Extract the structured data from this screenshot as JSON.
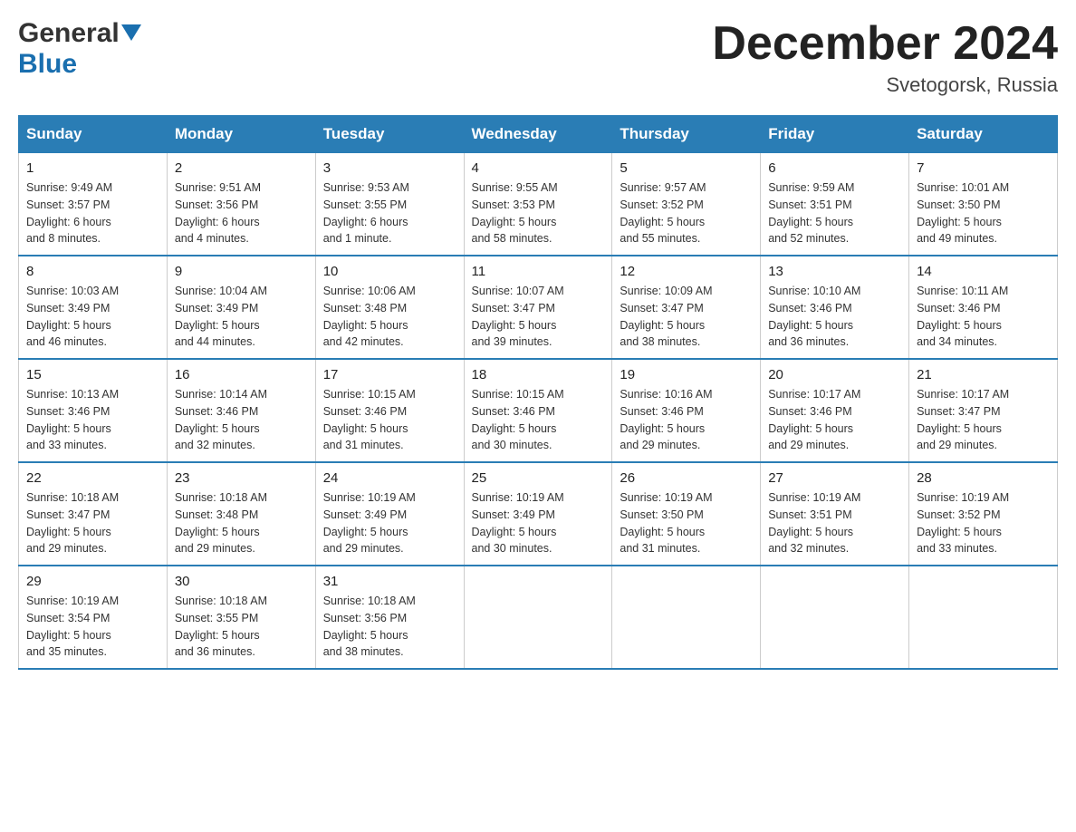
{
  "header": {
    "title": "December 2024",
    "location": "Svetogorsk, Russia",
    "logo_general": "General",
    "logo_blue": "Blue"
  },
  "days_of_week": [
    "Sunday",
    "Monday",
    "Tuesday",
    "Wednesday",
    "Thursday",
    "Friday",
    "Saturday"
  ],
  "weeks": [
    [
      {
        "day": "1",
        "sunrise": "Sunrise: 9:49 AM",
        "sunset": "Sunset: 3:57 PM",
        "daylight": "Daylight: 6 hours",
        "daylight2": "and 8 minutes."
      },
      {
        "day": "2",
        "sunrise": "Sunrise: 9:51 AM",
        "sunset": "Sunset: 3:56 PM",
        "daylight": "Daylight: 6 hours",
        "daylight2": "and 4 minutes."
      },
      {
        "day": "3",
        "sunrise": "Sunrise: 9:53 AM",
        "sunset": "Sunset: 3:55 PM",
        "daylight": "Daylight: 6 hours",
        "daylight2": "and 1 minute."
      },
      {
        "day": "4",
        "sunrise": "Sunrise: 9:55 AM",
        "sunset": "Sunset: 3:53 PM",
        "daylight": "Daylight: 5 hours",
        "daylight2": "and 58 minutes."
      },
      {
        "day": "5",
        "sunrise": "Sunrise: 9:57 AM",
        "sunset": "Sunset: 3:52 PM",
        "daylight": "Daylight: 5 hours",
        "daylight2": "and 55 minutes."
      },
      {
        "day": "6",
        "sunrise": "Sunrise: 9:59 AM",
        "sunset": "Sunset: 3:51 PM",
        "daylight": "Daylight: 5 hours",
        "daylight2": "and 52 minutes."
      },
      {
        "day": "7",
        "sunrise": "Sunrise: 10:01 AM",
        "sunset": "Sunset: 3:50 PM",
        "daylight": "Daylight: 5 hours",
        "daylight2": "and 49 minutes."
      }
    ],
    [
      {
        "day": "8",
        "sunrise": "Sunrise: 10:03 AM",
        "sunset": "Sunset: 3:49 PM",
        "daylight": "Daylight: 5 hours",
        "daylight2": "and 46 minutes."
      },
      {
        "day": "9",
        "sunrise": "Sunrise: 10:04 AM",
        "sunset": "Sunset: 3:49 PM",
        "daylight": "Daylight: 5 hours",
        "daylight2": "and 44 minutes."
      },
      {
        "day": "10",
        "sunrise": "Sunrise: 10:06 AM",
        "sunset": "Sunset: 3:48 PM",
        "daylight": "Daylight: 5 hours",
        "daylight2": "and 42 minutes."
      },
      {
        "day": "11",
        "sunrise": "Sunrise: 10:07 AM",
        "sunset": "Sunset: 3:47 PM",
        "daylight": "Daylight: 5 hours",
        "daylight2": "and 39 minutes."
      },
      {
        "day": "12",
        "sunrise": "Sunrise: 10:09 AM",
        "sunset": "Sunset: 3:47 PM",
        "daylight": "Daylight: 5 hours",
        "daylight2": "and 38 minutes."
      },
      {
        "day": "13",
        "sunrise": "Sunrise: 10:10 AM",
        "sunset": "Sunset: 3:46 PM",
        "daylight": "Daylight: 5 hours",
        "daylight2": "and 36 minutes."
      },
      {
        "day": "14",
        "sunrise": "Sunrise: 10:11 AM",
        "sunset": "Sunset: 3:46 PM",
        "daylight": "Daylight: 5 hours",
        "daylight2": "and 34 minutes."
      }
    ],
    [
      {
        "day": "15",
        "sunrise": "Sunrise: 10:13 AM",
        "sunset": "Sunset: 3:46 PM",
        "daylight": "Daylight: 5 hours",
        "daylight2": "and 33 minutes."
      },
      {
        "day": "16",
        "sunrise": "Sunrise: 10:14 AM",
        "sunset": "Sunset: 3:46 PM",
        "daylight": "Daylight: 5 hours",
        "daylight2": "and 32 minutes."
      },
      {
        "day": "17",
        "sunrise": "Sunrise: 10:15 AM",
        "sunset": "Sunset: 3:46 PM",
        "daylight": "Daylight: 5 hours",
        "daylight2": "and 31 minutes."
      },
      {
        "day": "18",
        "sunrise": "Sunrise: 10:15 AM",
        "sunset": "Sunset: 3:46 PM",
        "daylight": "Daylight: 5 hours",
        "daylight2": "and 30 minutes."
      },
      {
        "day": "19",
        "sunrise": "Sunrise: 10:16 AM",
        "sunset": "Sunset: 3:46 PM",
        "daylight": "Daylight: 5 hours",
        "daylight2": "and 29 minutes."
      },
      {
        "day": "20",
        "sunrise": "Sunrise: 10:17 AM",
        "sunset": "Sunset: 3:46 PM",
        "daylight": "Daylight: 5 hours",
        "daylight2": "and 29 minutes."
      },
      {
        "day": "21",
        "sunrise": "Sunrise: 10:17 AM",
        "sunset": "Sunset: 3:47 PM",
        "daylight": "Daylight: 5 hours",
        "daylight2": "and 29 minutes."
      }
    ],
    [
      {
        "day": "22",
        "sunrise": "Sunrise: 10:18 AM",
        "sunset": "Sunset: 3:47 PM",
        "daylight": "Daylight: 5 hours",
        "daylight2": "and 29 minutes."
      },
      {
        "day": "23",
        "sunrise": "Sunrise: 10:18 AM",
        "sunset": "Sunset: 3:48 PM",
        "daylight": "Daylight: 5 hours",
        "daylight2": "and 29 minutes."
      },
      {
        "day": "24",
        "sunrise": "Sunrise: 10:19 AM",
        "sunset": "Sunset: 3:49 PM",
        "daylight": "Daylight: 5 hours",
        "daylight2": "and 29 minutes."
      },
      {
        "day": "25",
        "sunrise": "Sunrise: 10:19 AM",
        "sunset": "Sunset: 3:49 PM",
        "daylight": "Daylight: 5 hours",
        "daylight2": "and 30 minutes."
      },
      {
        "day": "26",
        "sunrise": "Sunrise: 10:19 AM",
        "sunset": "Sunset: 3:50 PM",
        "daylight": "Daylight: 5 hours",
        "daylight2": "and 31 minutes."
      },
      {
        "day": "27",
        "sunrise": "Sunrise: 10:19 AM",
        "sunset": "Sunset: 3:51 PM",
        "daylight": "Daylight: 5 hours",
        "daylight2": "and 32 minutes."
      },
      {
        "day": "28",
        "sunrise": "Sunrise: 10:19 AM",
        "sunset": "Sunset: 3:52 PM",
        "daylight": "Daylight: 5 hours",
        "daylight2": "and 33 minutes."
      }
    ],
    [
      {
        "day": "29",
        "sunrise": "Sunrise: 10:19 AM",
        "sunset": "Sunset: 3:54 PM",
        "daylight": "Daylight: 5 hours",
        "daylight2": "and 35 minutes."
      },
      {
        "day": "30",
        "sunrise": "Sunrise: 10:18 AM",
        "sunset": "Sunset: 3:55 PM",
        "daylight": "Daylight: 5 hours",
        "daylight2": "and 36 minutes."
      },
      {
        "day": "31",
        "sunrise": "Sunrise: 10:18 AM",
        "sunset": "Sunset: 3:56 PM",
        "daylight": "Daylight: 5 hours",
        "daylight2": "and 38 minutes."
      },
      null,
      null,
      null,
      null
    ]
  ]
}
